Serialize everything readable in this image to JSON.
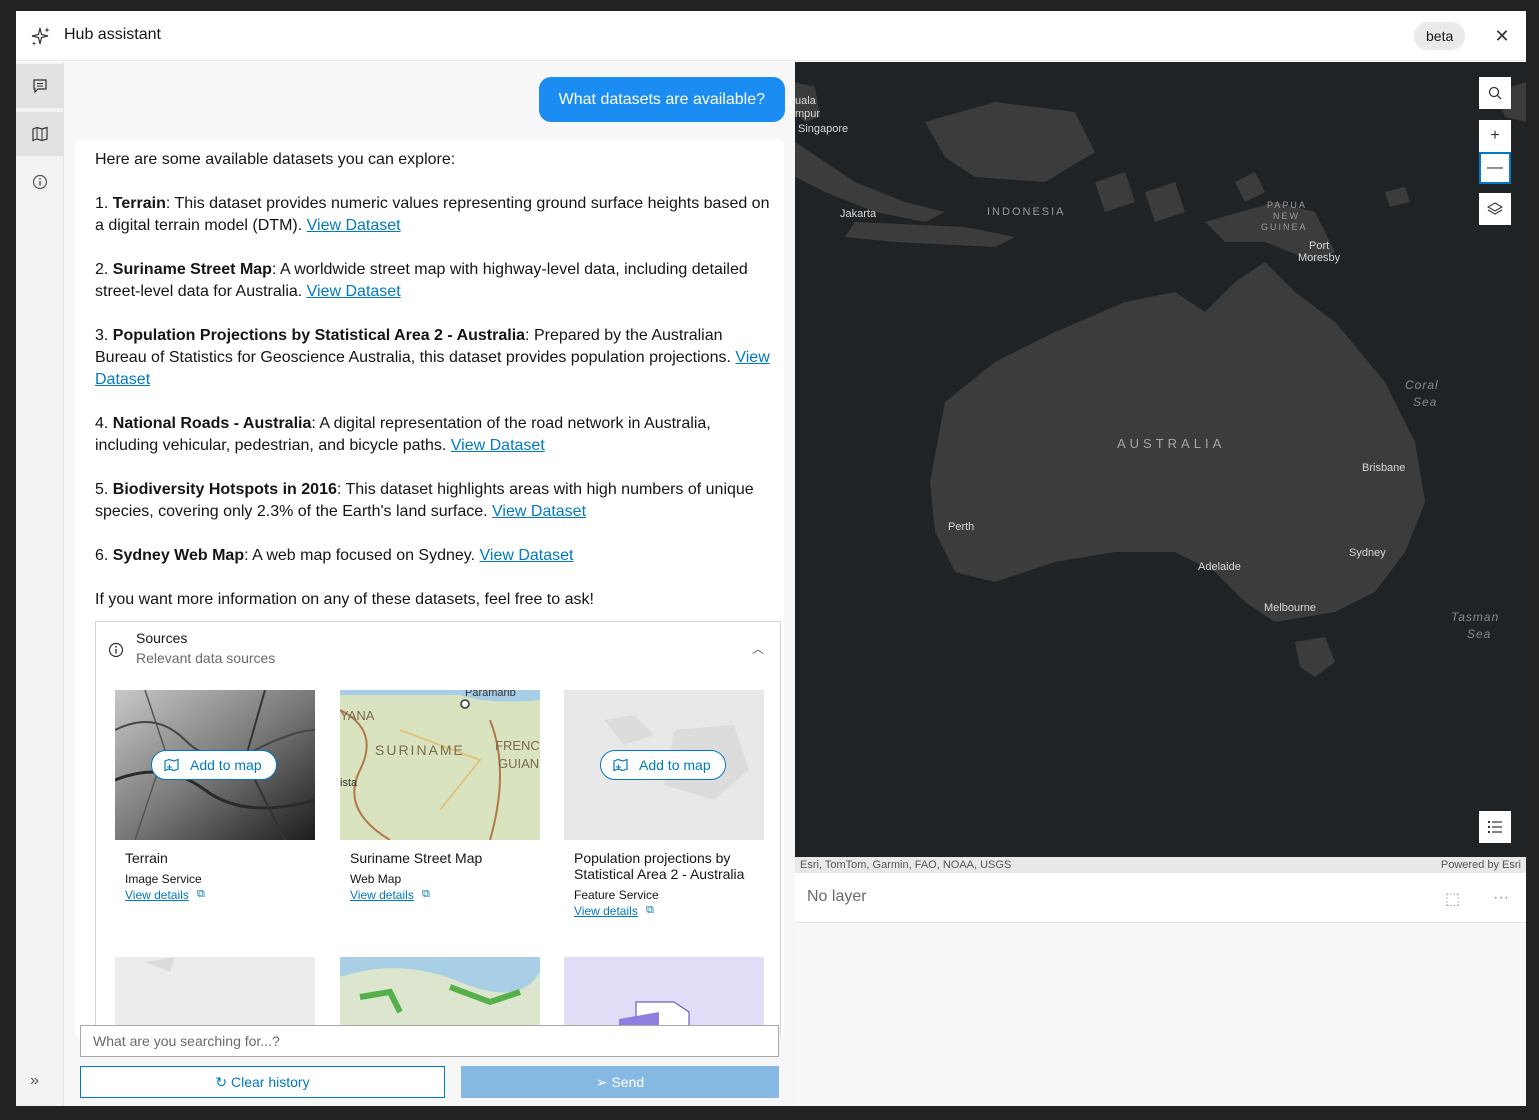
{
  "header": {
    "title": "Hub assistant",
    "badge": "beta"
  },
  "chat": {
    "user_message": "What datasets are available?",
    "answer": {
      "intro": "Here are some available datasets you can explore:",
      "items": [
        {
          "num": "1.",
          "name": "Terrain",
          "desc": ": This dataset provides numeric values representing ground surface heights based on a digital terrain model (DTM). ",
          "link": "View Dataset"
        },
        {
          "num": "2.",
          "name": "Suriname Street Map",
          "desc": ": A worldwide street map with highway-level data, including detailed street-level data for Australia. ",
          "link": "View Dataset"
        },
        {
          "num": "3.",
          "name": "Population Projections by Statistical Area 2 - Australia",
          "desc": ": Prepared by the Australian Bureau of Statistics for Geoscience Australia, this dataset provides population projections. ",
          "link": "View Dataset"
        },
        {
          "num": "4.",
          "name": "National Roads - Australia",
          "desc": ": A digital representation of the road network in Australia, including vehicular, pedestrian, and bicycle paths. ",
          "link": "View Dataset"
        },
        {
          "num": "5.",
          "name": "Biodiversity Hotspots in 2016",
          "desc": ": This dataset highlights areas with high numbers of unique species, covering only 2.3% of the Earth's land surface. ",
          "link": "View Dataset"
        },
        {
          "num": "6.",
          "name": "Sydney Web Map",
          "desc": ": A web map focused on Sydney. ",
          "link": "View Dataset"
        }
      ],
      "outro": "If you want more information on any of these datasets, feel free to ask!"
    },
    "sources": {
      "title": "Sources",
      "subtitle": "Relevant data sources",
      "add_label": "Add to map",
      "cards": [
        {
          "title": "Terrain",
          "type": "Image Service",
          "link": "View details"
        },
        {
          "title": "Suriname Street Map",
          "type": "Web Map",
          "link": "View details"
        },
        {
          "title": "Population projections by Statistical Area 2 - Australia",
          "type": "Feature Service",
          "link": "View details"
        }
      ],
      "thumb_texts": {
        "suriname": "SURINAME",
        "yana": "YANA",
        "frenc": "FRENC",
        "guian": "GUIAN",
        "paramarib": "Paramarib",
        "ista": "ista"
      }
    },
    "composer": {
      "placeholder": "What are you searching for...?",
      "clear_label": "Clear history",
      "send_label": "Send"
    }
  },
  "map": {
    "places": [
      {
        "name": "uala",
        "key": "kl1"
      },
      {
        "name": "mpur",
        "key": "kl2"
      },
      {
        "name": "Singapore",
        "key": "sg"
      },
      {
        "name": "Jakarta",
        "key": "jk"
      },
      {
        "name": "INDONESIA",
        "key": "id"
      },
      {
        "name": "PAPUA",
        "key": "png1"
      },
      {
        "name": "NEW",
        "key": "png2"
      },
      {
        "name": "GUINEA",
        "key": "png3"
      },
      {
        "name": "Port",
        "key": "pm1"
      },
      {
        "name": "Moresby",
        "key": "pm2"
      },
      {
        "name": "AUSTRALIA",
        "key": "au"
      },
      {
        "name": "Brisbane",
        "key": "br"
      },
      {
        "name": "Perth",
        "key": "pe"
      },
      {
        "name": "Sydney",
        "key": "sy"
      },
      {
        "name": "Adelaide",
        "key": "ad"
      },
      {
        "name": "Melbourne",
        "key": "me"
      },
      {
        "name": "Coral",
        "key": "cs1"
      },
      {
        "name": "Sea",
        "key": "cs2"
      },
      {
        "name": "Tasman",
        "key": "ts1"
      },
      {
        "name": "Sea",
        "key": "ts2"
      }
    ],
    "attribution_left": "Esri, TomTom, Garmin, FAO, NOAA, USGS",
    "attribution_right": "Powered by Esri",
    "tools": [
      "search-icon",
      "zoom-in-icon",
      "zoom-out-icon",
      "layers-icon",
      "legend-icon"
    ]
  },
  "layerbar": {
    "label": "No layer"
  },
  "colors": {
    "accent": "#007ac2",
    "user_bubble": "#1a8cf2",
    "send_disabled": "#86b9e2",
    "map_water": "#1f2326",
    "map_land": "#3c3c3c"
  }
}
